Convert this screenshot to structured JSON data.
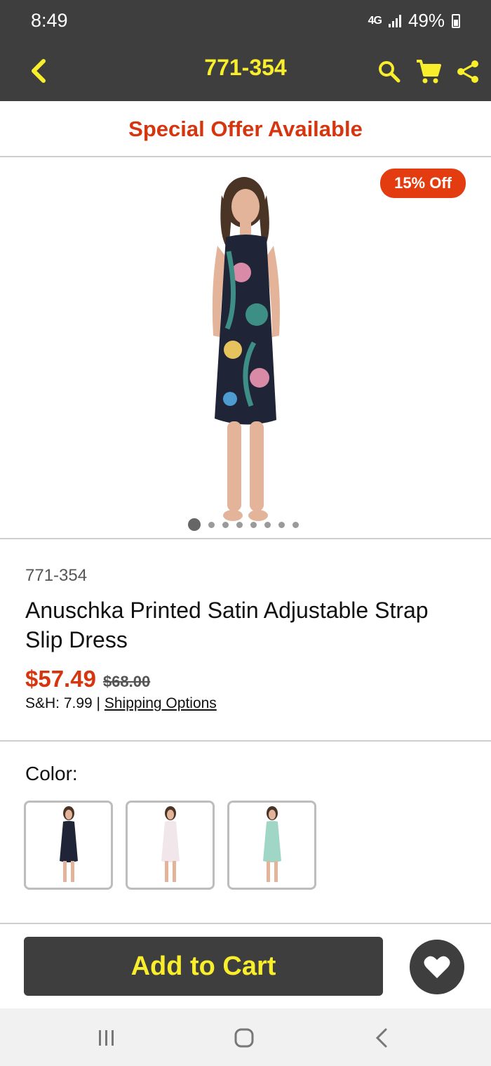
{
  "status_bar": {
    "time": "8:49",
    "network": "4G",
    "battery": "49%"
  },
  "app_bar": {
    "title": "771-354"
  },
  "offer_banner": "Special Offer Available",
  "hero": {
    "badge": "15% Off",
    "image_count": 8,
    "active_image": 1
  },
  "product": {
    "sku": "771-354",
    "name": "Anuschka Printed Satin Adjustable Strap Slip Dress",
    "price": "$57.49",
    "original_price": "$68.00",
    "shipping_prefix": "S&H: 7.99 | ",
    "shipping_link": "Shipping Options"
  },
  "color": {
    "label": "Color:",
    "swatches": [
      {
        "name": "navy floral",
        "color": "#1f2436"
      },
      {
        "name": "white floral",
        "color": "#f1e6ea"
      },
      {
        "name": "mint floral",
        "color": "#9fd6c6"
      }
    ]
  },
  "actions": {
    "add_to_cart": "Add to Cart"
  },
  "theme": {
    "bar": "#3e3e3e",
    "accent_yellow": "#f8ee2c",
    "accent_red": "#d6360f"
  }
}
